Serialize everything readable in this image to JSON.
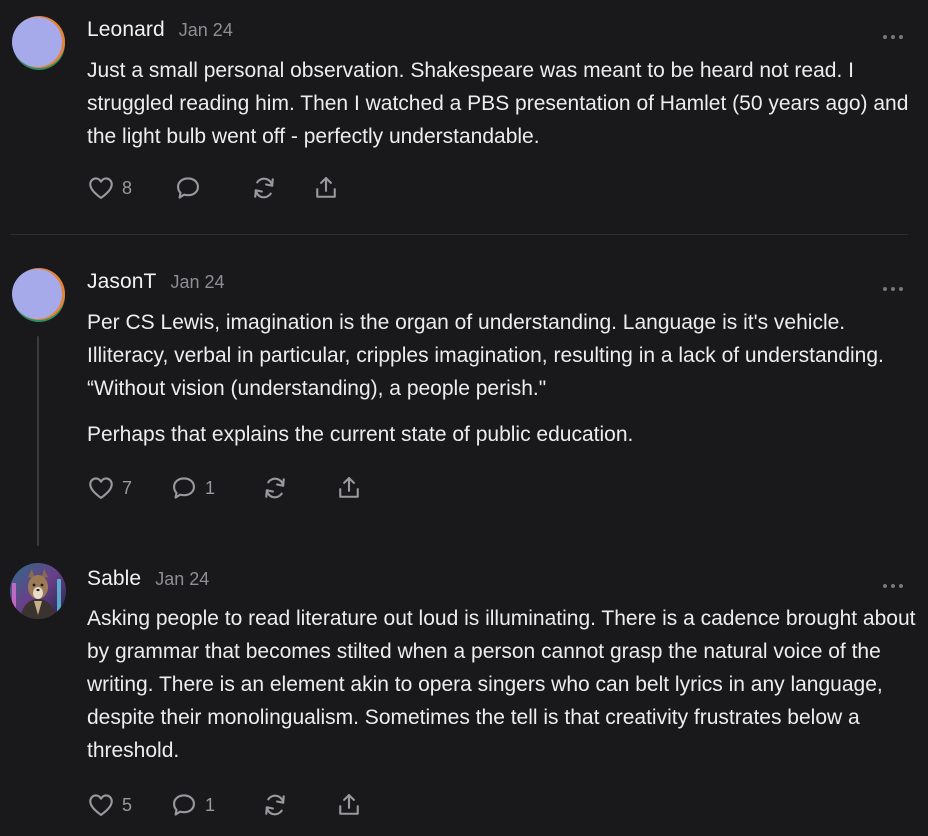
{
  "comments": [
    {
      "author": "Leonard",
      "date": "Jan 24",
      "paragraphs": [
        "Just a small personal observation. Shakespeare was meant to be heard not read. I struggled reading him. Then I watched a PBS presentation of Hamlet (50 years ago) and the light bulb went off - perfectly understandable."
      ],
      "likes": "8",
      "replies": ""
    },
    {
      "author": "JasonT",
      "date": "Jan 24",
      "paragraphs": [
        "Per CS Lewis, imagination is the organ of understanding. Language is it's vehicle. Illiteracy, verbal in particular, cripples imagination, resulting in a lack of understanding. “Without vision (understanding), a people perish.\"",
        "Perhaps that explains the current state of public education."
      ],
      "likes": "7",
      "replies": "1"
    },
    {
      "author": "Sable",
      "date": "Jan 24",
      "paragraphs": [
        "Asking people to read literature out loud is illuminating. There is a cadence brought about by grammar that becomes stilted when a person cannot grasp the natural voice of the writing. There is an element akin to opera singers who can belt lyrics in any language, despite their monolingualism. Sometimes the tell is that creativity frustrates below a threshold."
      ],
      "likes": "5",
      "replies": "1"
    }
  ],
  "icons": {
    "like": "heart-icon",
    "reply": "speech-bubble-icon",
    "restack": "restack-arrows-icon",
    "share": "share-upload-icon",
    "more": "ellipsis-icon"
  },
  "colors": {
    "background": "#19191b",
    "text": "#ededed",
    "muted": "#8e8e93",
    "divider": "#2e2e31"
  }
}
